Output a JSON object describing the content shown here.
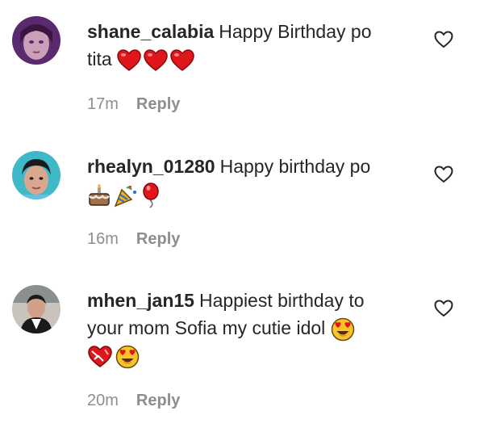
{
  "comments": [
    {
      "username": "shane_calabia",
      "text": "Happy Birthday po",
      "text_cont": "tita",
      "emojis": [
        "red-heart",
        "red-heart",
        "red-heart"
      ],
      "time": "17m",
      "reply_label": "Reply"
    },
    {
      "username": "rhealyn_01280",
      "text": "Happy birthday po",
      "emojis": [
        "birthday-cake",
        "party-popper",
        "balloon"
      ],
      "time": "16m",
      "reply_label": "Reply"
    },
    {
      "username": "mhen_jan15",
      "text": "Happiest birthday to",
      "text_cont": "your mom Sofia my cutie idol",
      "emojis_inline": [
        "heart-eyes-face"
      ],
      "emojis": [
        "heart-with-ribbon",
        "heart-eyes-face"
      ],
      "time": "20m",
      "reply_label": "Reply"
    }
  ],
  "colors": {
    "username": "#262626",
    "meta": "#8e8e8e",
    "heart": "#e0161d"
  },
  "icons": {
    "like": "heart-outline-icon"
  }
}
